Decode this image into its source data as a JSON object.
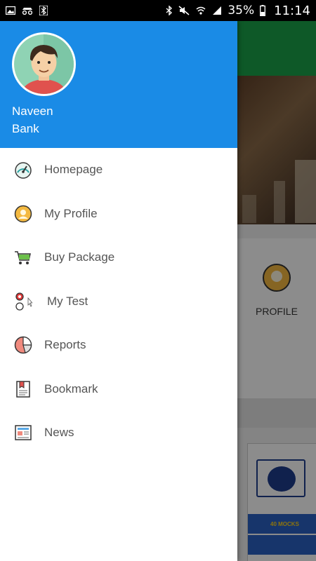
{
  "status_bar": {
    "battery_percent": "35%",
    "time": "11:14"
  },
  "background_screen": {
    "profile_tile_label": "PROFILE",
    "package_ribbon": "40 MOCKS"
  },
  "drawer": {
    "user": {
      "name": "Naveen\nBank"
    },
    "menu": [
      {
        "label": "Homepage",
        "icon": "speedometer-icon"
      },
      {
        "label": "My Profile",
        "icon": "profile-icon"
      },
      {
        "label": "Buy Package",
        "icon": "shopping-cart-icon"
      },
      {
        "label": "My Test",
        "icon": "test-icon"
      },
      {
        "label": "Reports",
        "icon": "pie-chart-icon"
      },
      {
        "label": "Bookmark",
        "icon": "bookmark-icon"
      },
      {
        "label": "News",
        "icon": "newspaper-icon"
      }
    ]
  },
  "colors": {
    "drawer_header": "#1a8be6",
    "toolbar": "#1aa34a"
  }
}
